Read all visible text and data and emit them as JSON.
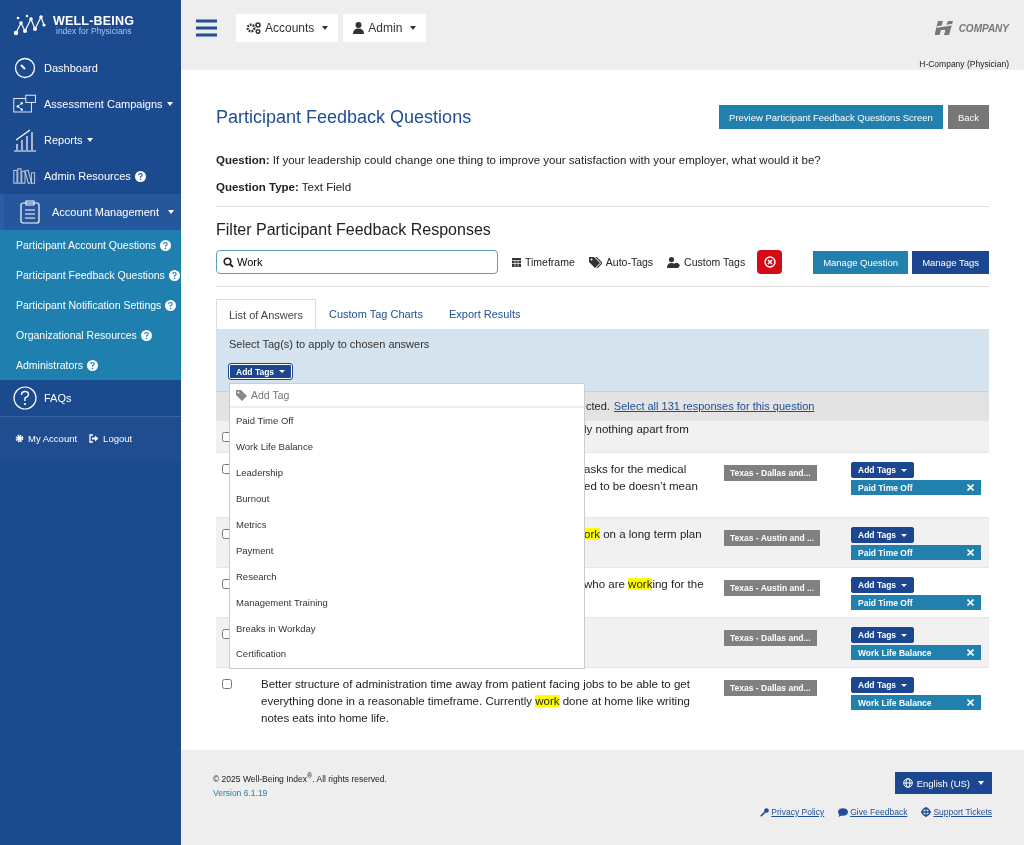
{
  "brand": {
    "name": "WELL-BEING",
    "tagline": "index for Physicians"
  },
  "sidebar": {
    "items": [
      {
        "label": "Dashboard",
        "kind": "dashboard",
        "caret": false,
        "help": false,
        "selected": false
      },
      {
        "label": "Assessment Campaigns",
        "kind": "campaigns",
        "caret": true,
        "help": false,
        "selected": false
      },
      {
        "label": "Reports",
        "kind": "reports",
        "caret": true,
        "help": false,
        "selected": false
      },
      {
        "label": "Admin Resources",
        "kind": "resources",
        "caret": false,
        "help": true,
        "selected": false
      },
      {
        "label": "Account Management",
        "kind": "account",
        "caret": true,
        "help": false,
        "selected": true,
        "expanded": true,
        "children": [
          {
            "label": "Participant Account Questions",
            "help": true
          },
          {
            "label": "Participant Feedback Questions",
            "help": true
          },
          {
            "label": "Participant Notification Settings",
            "help": true
          },
          {
            "label": "Organizational Resources",
            "help": true
          },
          {
            "label": "Administrators",
            "help": true
          }
        ]
      },
      {
        "label": "FAQs",
        "kind": "faq",
        "caret": false,
        "help": false,
        "selected": false
      }
    ],
    "footer_links": [
      {
        "label": "My Account",
        "kind": "gear"
      },
      {
        "label": "Logout",
        "kind": "logout"
      }
    ]
  },
  "topbar": {
    "menus": [
      {
        "label": "Accounts",
        "kind": "gears"
      },
      {
        "label": "Admin",
        "kind": "user"
      }
    ],
    "company_logo": "COMPANY",
    "account_name": "H-Company (Physician)"
  },
  "page": {
    "title": "Participant Feedback Questions",
    "buttons": [
      {
        "label": "Preview Participant Feedback Questions Screen",
        "kind": "primary"
      },
      {
        "label": "Back",
        "kind": "secondary"
      }
    ],
    "question": {
      "label": "Question:",
      "text": "If your leadership could change one thing to improve your satisfaction with your employer, what would it be?"
    },
    "question_type": {
      "label": "Question Type:",
      "text": "Text Field"
    }
  },
  "filter": {
    "title": "Filter Participant Feedback Responses",
    "search": {
      "value": "Work"
    },
    "options": [
      {
        "label": "Timeframe",
        "kind": "calendar"
      },
      {
        "label": "Auto-Tags",
        "kind": "tags"
      },
      {
        "label": "Custom Tags",
        "kind": "user-tag"
      }
    ],
    "buttons": [
      {
        "label": "Manage Question",
        "kind": "primary"
      },
      {
        "label": "Manage Tags",
        "kind": "dark"
      }
    ]
  },
  "tabs": [
    {
      "label": "List of Answers",
      "selected": true
    },
    {
      "label": "Custom Tag Charts",
      "selected": false
    },
    {
      "label": "Export Results",
      "selected": false
    }
  ],
  "tag_panel": {
    "text": "Select Tag(s) to apply to chosen answers",
    "button": "Add Tags",
    "dropdown": {
      "open": true,
      "placeholder": "Add Tag",
      "items": [
        "Paid Time Off",
        "Work Life Balance",
        "Leadership",
        "Burnout",
        "Metrics",
        "Payment",
        "Research",
        "Management Training",
        "Breaks in Workday",
        "Certification"
      ]
    }
  },
  "selection_notice": {
    "text": "cted.",
    "link": "Select all 131 responses for this question"
  },
  "rows": [
    {
      "kind": "covered",
      "checked": false,
      "lines": [
        [
          {
            "text": "ly nothing apart from",
            "highlight": false
          }
        ]
      ]
    },
    {
      "kind": "covered",
      "checked": false,
      "lines": [
        [
          {
            "text": "asks for the medical",
            "highlight": false
          }
        ],
        [
          {
            "text": "ed to be doesn’t mean",
            "highlight": false
          }
        ]
      ],
      "location": "Texas - Dallas and...",
      "add_tags": "Add Tags",
      "tags": [
        "Paid Time Off"
      ]
    },
    {
      "kind": "covered",
      "checked": false,
      "lines": [
        [
          {
            "text": "ork",
            "highlight": true
          },
          {
            "text": " on a long term plan",
            "highlight": false
          }
        ]
      ],
      "location": "Texas - Austin and ...",
      "add_tags": "Add Tags",
      "tags": [
        "Paid Time Off"
      ]
    },
    {
      "kind": "covered",
      "checked": false,
      "lines": [
        [
          {
            "text": "who are ",
            "highlight": false
          },
          {
            "text": "work",
            "highlight": true
          },
          {
            "text": "ing for the",
            "highlight": false
          }
        ]
      ],
      "location": "Texas - Austin and ...",
      "add_tags": "Add Tags",
      "tags": [
        "Paid Time Off"
      ]
    },
    {
      "kind": "covered",
      "checked": false,
      "lines": [],
      "location": "Texas - Dallas and...",
      "add_tags": "Add Tags",
      "tags": [
        "Work Life Balance"
      ]
    },
    {
      "kind": "full",
      "checked": false,
      "lines": [
        [
          {
            "text": "Better structure of administration time away from patient facing jobs to be able to get everything done in a reasonable timeframe. Currently ",
            "highlight": false
          },
          {
            "text": "work",
            "highlight": true
          },
          {
            "text": " done at home like writing notes eats into home life.",
            "highlight": false
          }
        ]
      ],
      "location": "Texas - Dallas and...",
      "add_tags": "Add Tags",
      "tags": [
        "Work Life Balance"
      ]
    }
  ],
  "footer": {
    "copyright": "© 2025 Well-Being Index$^{®}$. All rights reserved.",
    "version": "Version 6.1.19",
    "language": "English (US)",
    "links": [
      {
        "label": "Privacy Policy",
        "kind": "key"
      },
      {
        "label": "Give Feedback",
        "kind": "comment"
      },
      {
        "label": "Support Tickets",
        "kind": "lifebuoy"
      }
    ]
  }
}
